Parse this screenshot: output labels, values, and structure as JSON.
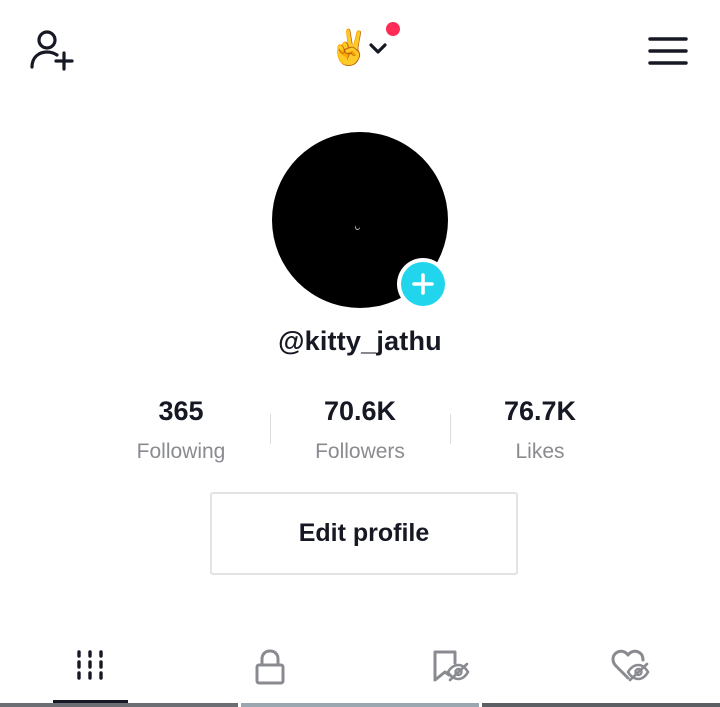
{
  "header": {
    "account_emoji": "✌️",
    "notification_dot_color": "#fe2c55",
    "icons": {
      "left": "add-friend-icon",
      "center": "chevron-down-icon",
      "right": "menu-icon"
    }
  },
  "profile": {
    "username": "@kitty_jathu",
    "avatar_add_color": "#20d5ec",
    "stats": [
      {
        "value": "365",
        "label": "Following"
      },
      {
        "value": "70.6K",
        "label": "Followers"
      },
      {
        "value": "76.7K",
        "label": "Likes"
      }
    ],
    "edit_button_label": "Edit profile"
  },
  "tabs": {
    "active_index": 0,
    "items": [
      {
        "icon": "grid-icon"
      },
      {
        "icon": "lock-icon"
      },
      {
        "icon": "bookmark-hidden-icon"
      },
      {
        "icon": "heart-hidden-icon"
      }
    ]
  }
}
